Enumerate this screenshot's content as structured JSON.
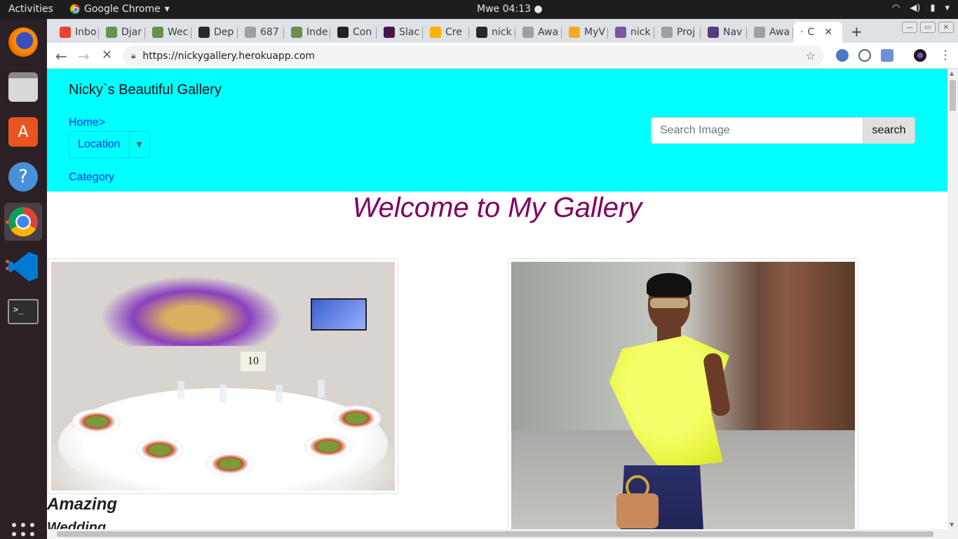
{
  "os": {
    "activities": "Activities",
    "app_name": "Google Chrome",
    "app_caret": "▾",
    "clock": "Mwe 04:13 ●",
    "tray": [
      "wifi-icon",
      "volume-icon",
      "battery-icon",
      "power-menu-icon"
    ]
  },
  "dock": {
    "items": [
      {
        "name": "firefox",
        "color": "#e66000"
      },
      {
        "name": "files",
        "color": "#9b9b9b"
      },
      {
        "name": "software",
        "color": "#e95420"
      },
      {
        "name": "help",
        "color": "#4a90d9"
      },
      {
        "name": "chrome",
        "color": "#4285f4"
      },
      {
        "name": "vscode",
        "color": "#0078d4"
      },
      {
        "name": "terminal",
        "color": "#2e2e2e"
      }
    ]
  },
  "browser": {
    "tabs": [
      {
        "label": "Inbo",
        "icon": "gmail-icon",
        "color": "#ea4335"
      },
      {
        "label": "Djar",
        "icon": "django-icon",
        "color": "#6a8f4f"
      },
      {
        "label": "Wec",
        "icon": "django-icon",
        "color": "#6a8f4f"
      },
      {
        "label": "Dep",
        "icon": "github-icon",
        "color": "#24292e"
      },
      {
        "label": "687",
        "icon": "doc-icon",
        "color": "#9aa0a6"
      },
      {
        "label": "Inde",
        "icon": "django-icon",
        "color": "#6a8f4f"
      },
      {
        "label": "Con",
        "icon": "w-icon",
        "color": "#222222"
      },
      {
        "label": "Slac",
        "icon": "slack-icon",
        "color": "#4a154b"
      },
      {
        "label": "Cre",
        "icon": "slides-icon",
        "color": "#f4b400"
      },
      {
        "label": "nick",
        "icon": "github-icon",
        "color": "#24292e"
      },
      {
        "label": "Awa",
        "icon": "doc-icon",
        "color": "#9aa0a6"
      },
      {
        "label": "MyV",
        "icon": "myw-icon",
        "color": "#f9a825"
      },
      {
        "label": "nick",
        "icon": "heroku-icon",
        "color": "#79589f"
      },
      {
        "label": "Proj",
        "icon": "doc-icon",
        "color": "#9aa0a6"
      },
      {
        "label": "Nav",
        "icon": "bootstrap-icon",
        "color": "#563d7c"
      },
      {
        "label": "Awa",
        "icon": "doc-icon",
        "color": "#9aa0a6"
      }
    ],
    "active_tab": {
      "label": "C",
      "icon": "loading-icon"
    },
    "close_glyph": "✕",
    "new_tab": "+",
    "url": "https://nickygallery.herokuapp.com"
  },
  "site": {
    "brand": "Nicky`s Beautiful Gallery",
    "home_link": "Home>",
    "location_button": "Location",
    "category_link": "Category",
    "search": {
      "placeholder": "Search Image",
      "button": "search"
    },
    "welcome": "Welcome to My Gallery",
    "images": [
      {
        "name": "banquet-image",
        "table_number": "10"
      },
      {
        "name": "fashion-image"
      }
    ],
    "caption_title": "Amazing",
    "caption_sub": "Wedding"
  },
  "colors": {
    "nav_bg": "#00ffff",
    "link": "#0033ff",
    "welcome": "#800060"
  }
}
